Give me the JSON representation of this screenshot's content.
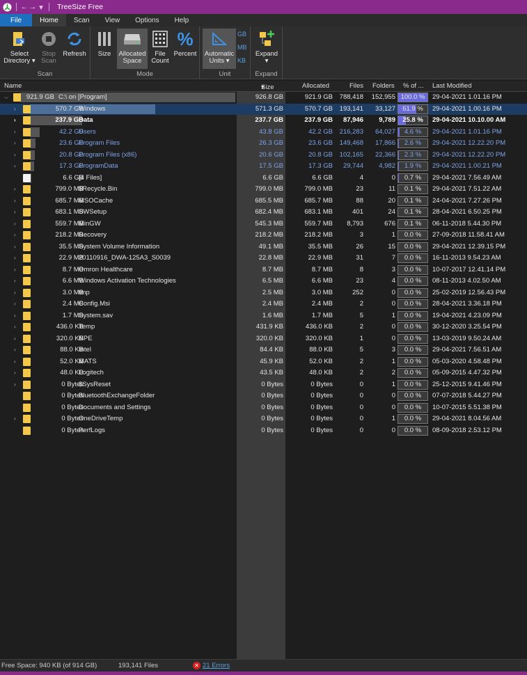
{
  "window": {
    "title": "TreeSize Free"
  },
  "tabs": [
    {
      "label": "File"
    },
    {
      "label": "Home"
    },
    {
      "label": "Scan"
    },
    {
      "label": "View"
    },
    {
      "label": "Options"
    },
    {
      "label": "Help"
    }
  ],
  "ribbon": {
    "scan": {
      "label": "Scan",
      "select_dir": "Select",
      "select_dir2": "Directory",
      "stop_scan": "Stop",
      "stop_scan2": "Scan",
      "refresh": "Refresh"
    },
    "mode": {
      "label": "Mode",
      "size": "Size",
      "allocated": "Allocated",
      "allocated2": "Space",
      "file_count": "File",
      "file_count2": "Count",
      "percent": "Percent"
    },
    "unit": {
      "label": "Unit",
      "automatic": "Automatic",
      "units": "Units",
      "gb": "GB",
      "mb": "MB",
      "kb": "KB"
    },
    "expand": {
      "label": "Expand",
      "expand": "Expand"
    }
  },
  "columns": {
    "name": "Name",
    "size": "Size",
    "allocated": "Allocated",
    "files": "Files",
    "folders": "Folders",
    "percent": "% of ...",
    "modified": "Last Modified"
  },
  "rows": [
    {
      "size": "921.9 GB",
      "name": "C:\\  on  [Program]",
      "size2": "926.8 GB",
      "allocated": "921.9 GB",
      "files": "788,418",
      "folders": "152,955",
      "pct": "100.0 %",
      "pctv": 100,
      "modified": "29-04-2021 1.01.16 PM"
    },
    {
      "size": "570.7 GB",
      "name": "Windows",
      "size2": "571.3 GB",
      "allocated": "570.7 GB",
      "files": "193,141",
      "folders": "33,127",
      "pct": "61.9 %",
      "pctv": 61.9,
      "modified": "29-04-2021 1.00.16 PM"
    },
    {
      "size": "237.9 GB",
      "name": "Data",
      "size2": "237.7 GB",
      "allocated": "237.9 GB",
      "files": "87,946",
      "folders": "9,789",
      "pct": "25.8 %",
      "pctv": 25.8,
      "modified": "29-04-2021 10.10.00 AM"
    },
    {
      "size": "42.2 GB",
      "name": "Users",
      "size2": "43.8 GB",
      "allocated": "42.2 GB",
      "files": "216,283",
      "folders": "64,027",
      "pct": "4.6 %",
      "pctv": 4.6,
      "modified": "29-04-2021 1.01.16 PM"
    },
    {
      "size": "23.6 GB",
      "name": "Program Files",
      "size2": "26.3 GB",
      "allocated": "23.6 GB",
      "files": "149,468",
      "folders": "17,866",
      "pct": "2.6 %",
      "pctv": 2.6,
      "modified": "29-04-2021 12.22.20 PM"
    },
    {
      "size": "20.8 GB",
      "name": "Program Files (x86)",
      "size2": "20.6 GB",
      "allocated": "20.8 GB",
      "files": "102,165",
      "folders": "22,366",
      "pct": "2.3 %",
      "pctv": 2.3,
      "modified": "29-04-2021 12.22.20 PM"
    },
    {
      "size": "17.3 GB",
      "name": "ProgramData",
      "size2": "17.5 GB",
      "allocated": "17.3 GB",
      "files": "29,744",
      "folders": "4,982",
      "pct": "1.9 %",
      "pctv": 1.9,
      "modified": "29-04-2021 1.00.21 PM"
    },
    {
      "size": "6.6 GB",
      "name": "[4 Files]",
      "size2": "6.6 GB",
      "allocated": "6.6 GB",
      "files": "4",
      "folders": "0",
      "pct": "0.7 %",
      "pctv": 0.7,
      "modified": "29-04-2021 7.56.49 AM"
    },
    {
      "size": "799.0 MB",
      "name": "$Recycle.Bin",
      "size2": "799.0 MB",
      "allocated": "799.0 MB",
      "files": "23",
      "folders": "11",
      "pct": "0.1 %",
      "pctv": 0.1,
      "modified": "29-04-2021 7.51.22 AM"
    },
    {
      "size": "685.7 MB",
      "name": "MSOCache",
      "size2": "685.5 MB",
      "allocated": "685.7 MB",
      "files": "88",
      "folders": "20",
      "pct": "0.1 %",
      "pctv": 0.1,
      "modified": "24-04-2021 7.27.26 PM"
    },
    {
      "size": "683.1 MB",
      "name": "SWSetup",
      "size2": "682.4 MB",
      "allocated": "683.1 MB",
      "files": "401",
      "folders": "24",
      "pct": "0.1 %",
      "pctv": 0.1,
      "modified": "28-04-2021 6.50.25 PM"
    },
    {
      "size": "559.7 MB",
      "name": "MinGW",
      "size2": "545.3 MB",
      "allocated": "559.7 MB",
      "files": "8,793",
      "folders": "676",
      "pct": "0.1 %",
      "pctv": 0.1,
      "modified": "06-11-2018 5.44.30 PM"
    },
    {
      "size": "218.2 MB",
      "name": "Recovery",
      "size2": "218.2 MB",
      "allocated": "218.2 MB",
      "files": "3",
      "folders": "1",
      "pct": "0.0 %",
      "pctv": 0,
      "modified": "27-09-2018 11.58.41 AM"
    },
    {
      "size": "35.5 MB",
      "name": "System Volume Information",
      "size2": "49.1 MB",
      "allocated": "35.5 MB",
      "files": "26",
      "folders": "15",
      "pct": "0.0 %",
      "pctv": 0,
      "modified": "29-04-2021 12.39.15 PM"
    },
    {
      "size": "22.9 MB",
      "name": "20110916_DWA-125A3_S0039",
      "size2": "22.8 MB",
      "allocated": "22.9 MB",
      "files": "31",
      "folders": "7",
      "pct": "0.0 %",
      "pctv": 0,
      "modified": "16-11-2013 9.54.23 AM"
    },
    {
      "size": "8.7 MB",
      "name": "Omron Healthcare",
      "size2": "8.7 MB",
      "allocated": "8.7 MB",
      "files": "8",
      "folders": "3",
      "pct": "0.0 %",
      "pctv": 0,
      "modified": "10-07-2017 12.41.14 PM"
    },
    {
      "size": "6.6 MB",
      "name": "Windows Activation Technologies",
      "size2": "6.5 MB",
      "allocated": "6.6 MB",
      "files": "23",
      "folders": "4",
      "pct": "0.0 %",
      "pctv": 0,
      "modified": "08-11-2013 4.02.50 AM"
    },
    {
      "size": "3.0 MB",
      "name": "tmp",
      "size2": "2.5 MB",
      "allocated": "3.0 MB",
      "files": "252",
      "folders": "0",
      "pct": "0.0 %",
      "pctv": 0,
      "modified": "25-02-2019 12.56.43 PM"
    },
    {
      "size": "2.4 MB",
      "name": "Config.Msi",
      "size2": "2.4 MB",
      "allocated": "2.4 MB",
      "files": "2",
      "folders": "0",
      "pct": "0.0 %",
      "pctv": 0,
      "modified": "28-04-2021 3.36.18 PM"
    },
    {
      "size": "1.7 MB",
      "name": "System.sav",
      "size2": "1.6 MB",
      "allocated": "1.7 MB",
      "files": "5",
      "folders": "1",
      "pct": "0.0 %",
      "pctv": 0,
      "modified": "19-04-2021 4.23.09 PM"
    },
    {
      "size": "436.0 KB",
      "name": "Temp",
      "size2": "431.9 KB",
      "allocated": "436.0 KB",
      "files": "2",
      "folders": "0",
      "pct": "0.0 %",
      "pctv": 0,
      "modified": "30-12-2020 3.25.54 PM"
    },
    {
      "size": "320.0 KB",
      "name": "NPE",
      "size2": "320.0 KB",
      "allocated": "320.0 KB",
      "files": "1",
      "folders": "0",
      "pct": "0.0 %",
      "pctv": 0,
      "modified": "13-03-2019 9.50.24 AM"
    },
    {
      "size": "88.0 KB",
      "name": "Intel",
      "size2": "84.4 KB",
      "allocated": "88.0 KB",
      "files": "5",
      "folders": "3",
      "pct": "0.0 %",
      "pctv": 0,
      "modified": "29-04-2021 7.56.51 AM"
    },
    {
      "size": "52.0 KB",
      "name": "MATS",
      "size2": "45.9 KB",
      "allocated": "52.0 KB",
      "files": "2",
      "folders": "1",
      "pct": "0.0 %",
      "pctv": 0,
      "modified": "05-03-2020 4.58.48 PM"
    },
    {
      "size": "48.0 KB",
      "name": "Logitech",
      "size2": "43.5 KB",
      "allocated": "48.0 KB",
      "files": "2",
      "folders": "2",
      "pct": "0.0 %",
      "pctv": 0,
      "modified": "05-09-2015 4.47.32 PM"
    },
    {
      "size": "0 Bytes",
      "name": "$SysReset",
      "size2": "0 Bytes",
      "allocated": "0 Bytes",
      "files": "0",
      "folders": "1",
      "pct": "0.0 %",
      "pctv": 0,
      "modified": "25-12-2015 9.41.46 PM"
    },
    {
      "size": "0 Bytes",
      "name": "BluetoothExchangeFolder",
      "size2": "0 Bytes",
      "allocated": "0 Bytes",
      "files": "0",
      "folders": "0",
      "pct": "0.0 %",
      "pctv": 0,
      "modified": "07-07-2018 5.44.27 PM"
    },
    {
      "size": "0 Bytes",
      "name": "Documents and Settings",
      "size2": "0 Bytes",
      "allocated": "0 Bytes",
      "files": "0",
      "folders": "0",
      "pct": "0.0 %",
      "pctv": 0,
      "modified": "10-07-2015 5.51.38 PM"
    },
    {
      "size": "0 Bytes",
      "name": "OneDriveTemp",
      "size2": "0 Bytes",
      "allocated": "0 Bytes",
      "files": "0",
      "folders": "1",
      "pct": "0.0 %",
      "pctv": 0,
      "modified": "29-04-2021 8.04.56 AM"
    },
    {
      "size": "0 Bytes",
      "name": "PerfLogs",
      "size2": "0 Bytes",
      "allocated": "0 Bytes",
      "files": "0",
      "folders": "0",
      "pct": "0.0 %",
      "pctv": 0,
      "modified": "08-09-2018 2.53.12 PM"
    }
  ],
  "status": {
    "free_space": "Free Space: 940 KB  (of 914 GB)",
    "files": "193,141 Files",
    "errors": "21 Errors"
  },
  "colors": {
    "accent": "#8b2a8d",
    "file_tab": "#1f6fbf",
    "folder": "#f3c84a",
    "link": "#7da4e8",
    "pct_fill": "#6a6adf"
  }
}
